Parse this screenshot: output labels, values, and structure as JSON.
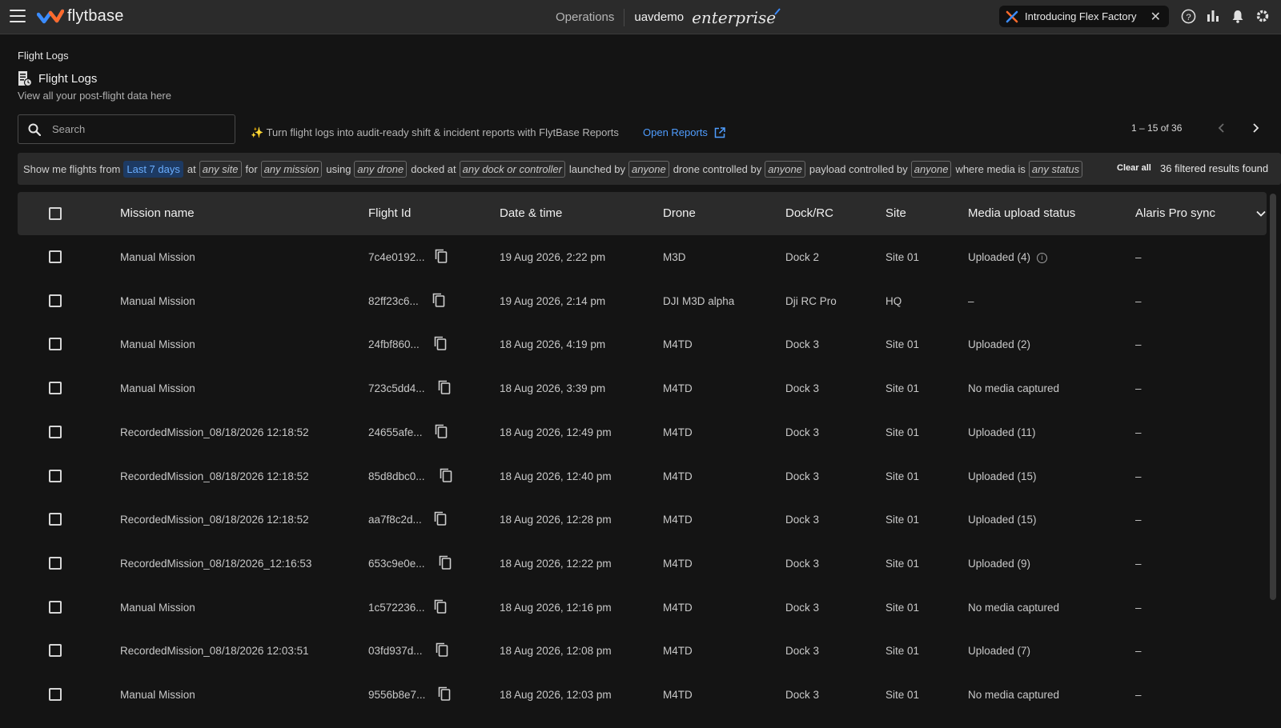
{
  "topbar": {
    "logo_text": "flytbase",
    "operations": "Operations",
    "org": "uavdemo",
    "plan": "enterprise",
    "announcement": "Introducing Flex Factory",
    "icons": [
      "help-icon",
      "analytics-icon",
      "notification-bell-icon",
      "settings-gear-icon"
    ]
  },
  "page": {
    "breadcrumb": "Flight Logs",
    "title": "Flight Logs",
    "subtitle": "View all your post-flight data here"
  },
  "toolbar": {
    "search_placeholder": "Search",
    "promo": "✨ Turn flight logs into audit-ready shift & incident reports with FlytBase Reports",
    "open_reports": "Open Reports",
    "pager": "1 – 15 of 36"
  },
  "filters": {
    "t1": "Show me flights from",
    "c1": "Last 7 days",
    "t2": "at",
    "c2": "any site",
    "t3": "for",
    "c3": "any mission",
    "t4": "using",
    "c4": "any drone",
    "t5": "docked at",
    "c5": "any dock or controller",
    "t6": "launched by",
    "c6": "anyone",
    "t7": "drone controlled by",
    "c7": "anyone",
    "t8": "payload controlled by",
    "c8": "anyone",
    "t9": "where media is",
    "c9": "any status",
    "clear_all": "Clear all",
    "results": "36 filtered results found"
  },
  "table": {
    "columns": {
      "mission": "Mission name",
      "flight_id": "Flight Id",
      "datetime": "Date & time",
      "drone": "Drone",
      "dock": "Dock/RC",
      "site": "Site",
      "media": "Media upload status",
      "sync": "Alaris Pro sync"
    },
    "rows": [
      {
        "mission": "Manual Mission",
        "flight_id": "7c4e0192...",
        "datetime": "19 Aug 2026, 2:22 pm",
        "drone": "M3D",
        "dock": "Dock 2",
        "site": "Site 01",
        "media": "Uploaded (4)",
        "sync": "–"
      },
      {
        "mission": "Manual Mission",
        "flight_id": "82ff23c6...",
        "datetime": "19 Aug 2026, 2:14 pm",
        "drone": "DJI M3D alpha",
        "dock": "Dji RC Pro",
        "site": "HQ",
        "media": "–",
        "sync": "–"
      },
      {
        "mission": "Manual Mission",
        "flight_id": "24fbf860...",
        "datetime": "18 Aug 2026, 4:19 pm",
        "drone": "M4TD",
        "dock": "Dock 3",
        "site": "Site 01",
        "media": "Uploaded (2)",
        "sync": "–"
      },
      {
        "mission": "Manual Mission",
        "flight_id": "723c5dd4...",
        "datetime": "18 Aug 2026, 3:39 pm",
        "drone": "M4TD",
        "dock": "Dock 3",
        "site": "Site 01",
        "media": "No media captured",
        "sync": "–"
      },
      {
        "mission": "RecordedMission_08/18/2026 12:18:52",
        "flight_id": "24655afe...",
        "datetime": "18 Aug 2026, 12:49 pm",
        "drone": "M4TD",
        "dock": "Dock 3",
        "site": "Site 01",
        "media": "Uploaded (11)",
        "sync": "–"
      },
      {
        "mission": "RecordedMission_08/18/2026 12:18:52",
        "flight_id": "85d8dbc0...",
        "datetime": "18 Aug 2026, 12:40 pm",
        "drone": "M4TD",
        "dock": "Dock 3",
        "site": "Site 01",
        "media": "Uploaded (15)",
        "sync": "–"
      },
      {
        "mission": "RecordedMission_08/18/2026 12:18:52",
        "flight_id": "aa7f8c2d...",
        "datetime": "18 Aug 2026, 12:28 pm",
        "drone": "M4TD",
        "dock": "Dock 3",
        "site": "Site 01",
        "media": "Uploaded (15)",
        "sync": "–"
      },
      {
        "mission": "RecordedMission_08/18/2026_12:16:53",
        "flight_id": "653c9e0e...",
        "datetime": "18 Aug 2026, 12:22 pm",
        "drone": "M4TD",
        "dock": "Dock 3",
        "site": "Site 01",
        "media": "Uploaded (9)",
        "sync": "–"
      },
      {
        "mission": "Manual Mission",
        "flight_id": "1c572236...",
        "datetime": "18 Aug 2026, 12:16 pm",
        "drone": "M4TD",
        "dock": "Dock 3",
        "site": "Site 01",
        "media": "No media captured",
        "sync": "–"
      },
      {
        "mission": "RecordedMission_08/18/2026 12:03:51",
        "flight_id": "03fd937d...",
        "datetime": "18 Aug 2026, 12:08 pm",
        "drone": "M4TD",
        "dock": "Dock 3",
        "site": "Site 01",
        "media": "Uploaded (7)",
        "sync": "–"
      },
      {
        "mission": "Manual Mission",
        "flight_id": "9556b8e7...",
        "datetime": "18 Aug 2026, 12:03 pm",
        "drone": "M4TD",
        "dock": "Dock 3",
        "site": "Site 01",
        "media": "No media captured",
        "sync": "–"
      }
    ]
  },
  "colors": {
    "accent": "#4f9dff",
    "active_chip_bg": "#1d3a63",
    "background": "#141414",
    "header_bg": "#2b2b2b"
  }
}
